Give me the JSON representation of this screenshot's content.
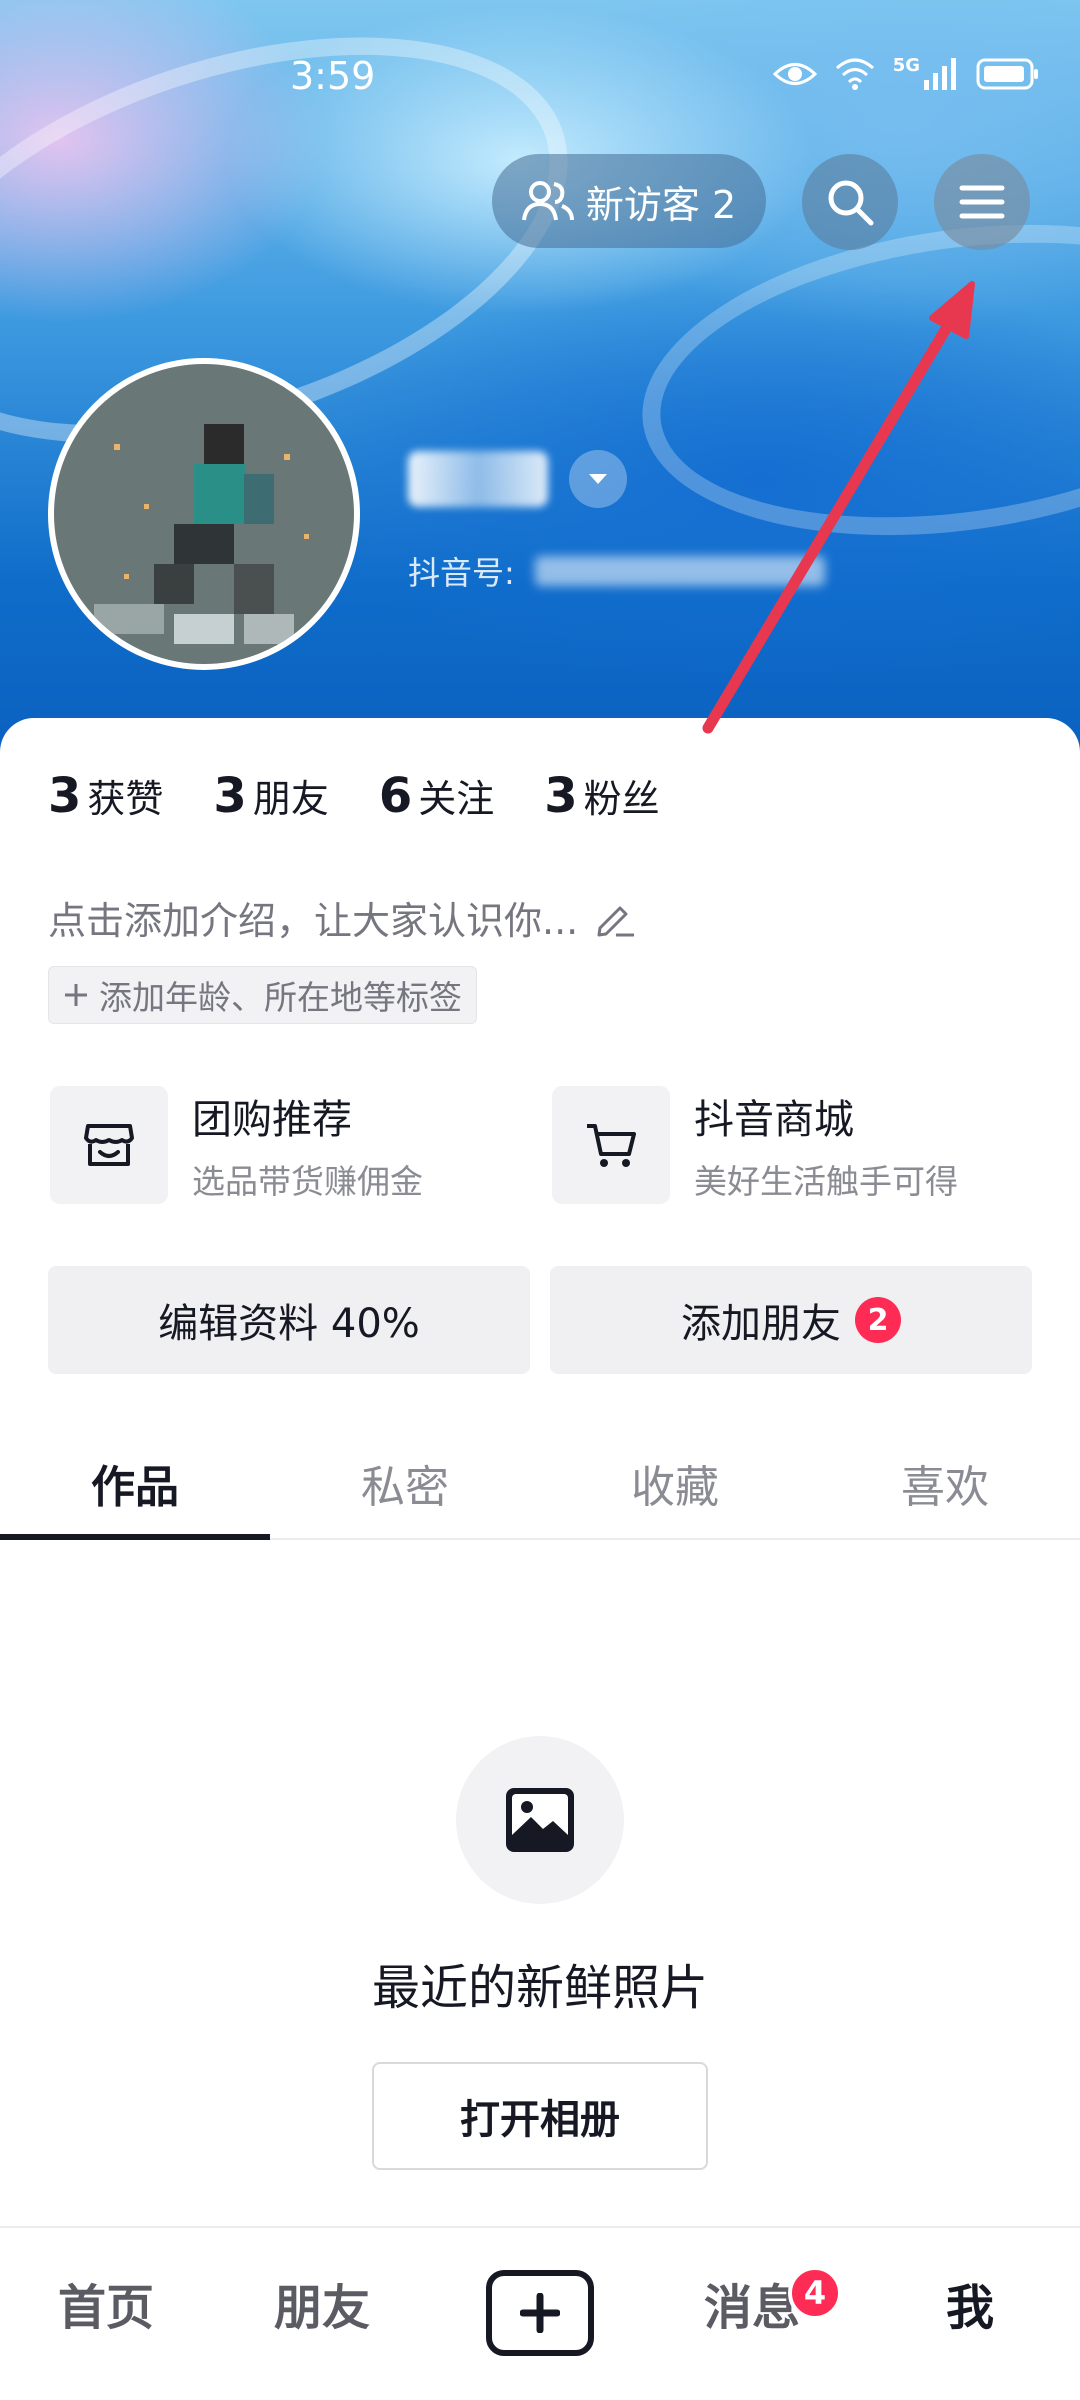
{
  "status_bar": {
    "time": "3:59",
    "network": "5G"
  },
  "header": {
    "visitors_label": "新访客 2",
    "search_icon": "search-icon",
    "menu_icon": "menu-icon"
  },
  "profile": {
    "douyin_id_label": "抖音号:"
  },
  "stats": [
    {
      "value": "3",
      "label": "获赞"
    },
    {
      "value": "3",
      "label": "朋友"
    },
    {
      "value": "6",
      "label": "关注"
    },
    {
      "value": "3",
      "label": "粉丝"
    }
  ],
  "bio": {
    "placeholder": "点击添加介绍，让大家认识你...",
    "tag_chip": "添加年龄、所在地等标签"
  },
  "services": [
    {
      "title": "团购推荐",
      "subtitle": "选品带货赚佣金"
    },
    {
      "title": "抖音商城",
      "subtitle": "美好生活触手可得"
    }
  ],
  "actions": {
    "edit_profile": "编辑资料 40%",
    "add_friends": "添加朋友",
    "add_friends_badge": "2"
  },
  "tabs": [
    "作品",
    "私密",
    "收藏",
    "喜欢"
  ],
  "empty_state": {
    "title": "最近的新鲜照片",
    "button": "打开相册"
  },
  "bottom_nav": {
    "home": "首页",
    "friends": "朋友",
    "messages": "消息",
    "messages_badge": "4",
    "me": "我"
  },
  "colors": {
    "accent_red": "#fe2c55",
    "text_primary": "#161823",
    "annotation_arrow": "#e8384f"
  }
}
